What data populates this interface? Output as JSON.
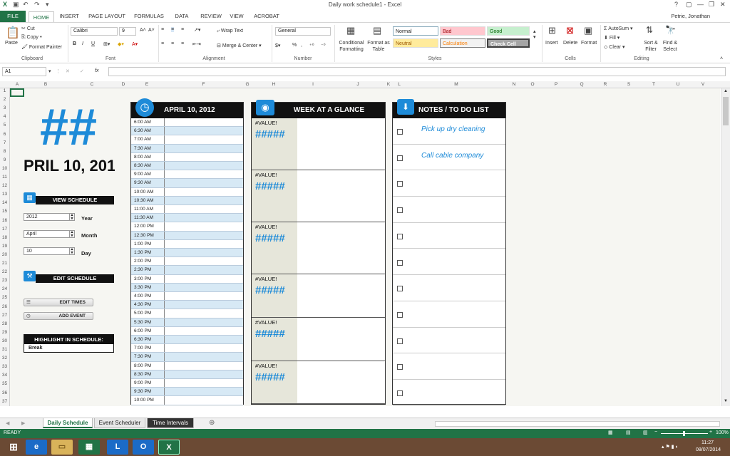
{
  "window": {
    "title": "Daily work schedule1 - Excel",
    "user": "Petrie, Jonathan"
  },
  "ribbon_tabs": [
    "FILE",
    "HOME",
    "INSERT",
    "PAGE LAYOUT",
    "FORMULAS",
    "DATA",
    "REVIEW",
    "VIEW",
    "ACROBAT"
  ],
  "clipboard": {
    "paste": "Paste",
    "cut": "Cut",
    "copy": "Copy",
    "format_painter": "Format Painter",
    "label": "Clipboard"
  },
  "font": {
    "name": "Calibri",
    "size": "9",
    "label": "Font",
    "bold": "B",
    "italic": "I",
    "underline": "U"
  },
  "alignment": {
    "wrap": "Wrap Text",
    "merge": "Merge & Center",
    "label": "Alignment"
  },
  "number": {
    "format": "General",
    "percent": "%",
    "label": "Number"
  },
  "styles": {
    "cond": "Conditional Formatting",
    "table": "Format as Table",
    "normal": "Normal",
    "bad": "Bad",
    "good": "Good",
    "neutral": "Neutral",
    "calculation": "Calculation",
    "check": "Check Cell",
    "label": "Styles"
  },
  "cells": {
    "insert": "Insert",
    "delete": "Delete",
    "format": "Format",
    "label": "Cells"
  },
  "editing": {
    "autosum": "AutoSum",
    "fill": "Fill",
    "clear": "Clear",
    "sort": "Sort & Filter",
    "find": "Find & Select",
    "label": "Editing"
  },
  "formula_bar": {
    "name_box": "A1",
    "fx": "fx",
    "content": ""
  },
  "columns": [
    "A",
    "B",
    "C",
    "D",
    "E",
    "F",
    "G",
    "H",
    "I",
    "J",
    "K",
    "L",
    "M",
    "N",
    "O",
    "P",
    "Q",
    "R",
    "S",
    "T",
    "U",
    "V"
  ],
  "rows": [
    "1",
    "2",
    "3",
    "4",
    "5",
    "6",
    "7",
    "8",
    "9",
    "10",
    "11",
    "12",
    "13",
    "14",
    "15",
    "16",
    "17",
    "18",
    "19",
    "20",
    "21",
    "22",
    "23",
    "24",
    "25",
    "26",
    "27",
    "28",
    "29",
    "30",
    "31",
    "32",
    "33",
    "34",
    "35",
    "36",
    "37"
  ],
  "left": {
    "big": "##",
    "date": "PRIL 10, 201",
    "view_schedule": "VIEW SCHEDULE",
    "year_val": "2012",
    "year_lbl": "Year",
    "month_val": "April",
    "month_lbl": "Month",
    "day_val": "10",
    "day_lbl": "Day",
    "edit_schedule": "EDIT SCHEDULE",
    "edit_times": "EDIT TIMES",
    "add_event": "ADD EVENT",
    "highlight": "HIGHLIGHT IN SCHEDULE:",
    "break": "Break"
  },
  "schedule": {
    "title": "APRIL 10, 2012",
    "times": [
      "6:00 AM",
      "6:30 AM",
      "7:00 AM",
      "7:30 AM",
      "8:00 AM",
      "8:30 AM",
      "9:00 AM",
      "9:30 AM",
      "10:00 AM",
      "10:30 AM",
      "11:00 AM",
      "11:30 AM",
      "12:00 PM",
      "12:30 PM",
      "1:00 PM",
      "1:30 PM",
      "2:00 PM",
      "2:30 PM",
      "3:00 PM",
      "3:30 PM",
      "4:00 PM",
      "4:30 PM",
      "5:00 PM",
      "5:30 PM",
      "6:00 PM",
      "6:30 PM",
      "7:00 PM",
      "7:30 PM",
      "8:00 PM",
      "8:30 PM",
      "9:00 PM",
      "9:30 PM",
      "10:00 PM"
    ]
  },
  "week": {
    "title": "WEEK AT A GLANCE",
    "days": [
      {
        "err": "#VALUE!",
        "hash": "#####"
      },
      {
        "err": "#VALUE!",
        "hash": "#####"
      },
      {
        "err": "#VALUE!",
        "hash": "#####"
      },
      {
        "err": "#VALUE!",
        "hash": "#####"
      },
      {
        "err": "#VALUE!",
        "hash": "#####"
      },
      {
        "err": "#VALUE!",
        "hash": "#####"
      }
    ]
  },
  "notes": {
    "title": "NOTES / TO DO LIST",
    "items": [
      "Pick up dry cleaning",
      "Call cable company",
      "",
      "",
      "",
      "",
      "",
      "",
      "",
      "",
      ""
    ]
  },
  "sheet_tabs": [
    "Daily Schedule",
    "Event Scheduler",
    "Time Intervals"
  ],
  "status": {
    "ready": "READY",
    "zoom": "100%"
  },
  "taskbar": {
    "time": "11:27",
    "date": "08/07/2014"
  },
  "colors": {
    "excel_green": "#217346",
    "accent_blue": "#1e8bd8"
  }
}
